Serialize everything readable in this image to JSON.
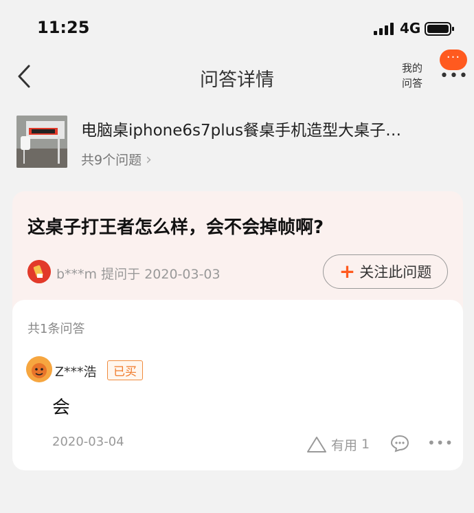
{
  "status_bar": {
    "time": "11:25",
    "network": "4G"
  },
  "nav": {
    "title": "问答详情",
    "my_answers_line1": "我的",
    "my_answers_line2": "问答",
    "message_badge": "···",
    "more": "•••"
  },
  "product": {
    "title": "电脑桌iphone6s7plus餐桌手机造型大桌子…",
    "question_count": "共9个问题",
    "chevron": "›"
  },
  "question": {
    "text": "这桌子打王者怎么样，会不会掉帧啊?",
    "asker": "b***m",
    "asked_label": "提问于",
    "asked_date": "2020-03-03",
    "follow_plus": "+",
    "follow_label": "关注此问题"
  },
  "answers": {
    "count_label": "共1条问答",
    "items": [
      {
        "user": "Z***浩",
        "badge": "已买",
        "text": "会",
        "date": "2020-03-04",
        "useful_label": "有用",
        "useful_count": "1"
      }
    ]
  },
  "colors": {
    "accent": "#ff5a1f",
    "question_bg": "#fbf1ef",
    "page_bg": "#f2f2f2"
  },
  "icons": [
    "signal-icon",
    "battery-icon",
    "back-icon",
    "more-icon",
    "chevron-right-icon",
    "plus-icon",
    "thumb-up-icon",
    "comment-icon"
  ]
}
